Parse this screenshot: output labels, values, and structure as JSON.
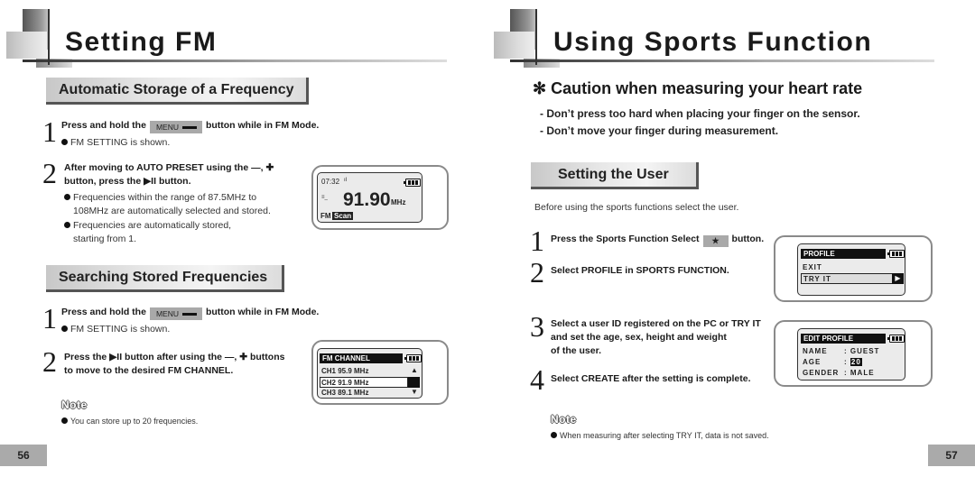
{
  "left_page": {
    "title": "Setting FM",
    "section1": {
      "heading": "Automatic Storage of a Frequency",
      "step1": {
        "num": "1",
        "text_before": "Press and hold the",
        "key_label": "MENU",
        "text_after": "button while in FM Mode.",
        "bullet": "FM SETTING is shown."
      },
      "step2": {
        "num": "2",
        "line1": "After moving to AUTO PRESET using the",
        "line1_symbols": "—, ✚",
        "line2_before": "button, press the",
        "line2_symbol": "▶II",
        "line2_after": "button.",
        "bullet1_line1": "Frequencies within the range of 87.5MHz to",
        "bullet1_line2": "108MHz are automatically selected and stored.",
        "bullet2_line1": "Frequencies are automatically stored,",
        "bullet2_line2": "starting from 1."
      },
      "lcd": {
        "time": "07:32",
        "frequency": "91.90",
        "unit": "MHz",
        "mode": "FM",
        "action": "Scan"
      }
    },
    "section2": {
      "heading": "Searching Stored Frequencies",
      "step1": {
        "num": "1",
        "text_before": "Press and hold the",
        "key_label": "MENU",
        "text_after": "button while in FM Mode.",
        "bullet": "FM SETTING is shown."
      },
      "step2": {
        "num": "2",
        "line1_before": "Press the",
        "line1_symbol": "▶II",
        "line1_mid": "button after using the",
        "line1_symbols": "—, ✚",
        "line1_after": "buttons",
        "line2": "to move to the desired FM CHANNEL."
      },
      "lcd": {
        "header": "FM CHANNEL",
        "channels": [
          {
            "label": "CH1  95.9 MHz",
            "selected": false
          },
          {
            "label": "CH2  91.9 MHz",
            "selected": true
          },
          {
            "label": "CH3  89.1 MHz",
            "selected": false
          }
        ],
        "up_arrow": "▲",
        "down_arrow": "▼"
      }
    },
    "note": {
      "label": "Note",
      "text": "You can store up to 20 frequencies."
    },
    "page_number": "56"
  },
  "right_page": {
    "title": "Using Sports Function",
    "caution": {
      "title": "✻ Caution when measuring your heart rate",
      "lines": [
        "- Don’t press too hard when placing your finger on the sensor.",
        "- Don’t move your finger during measurement."
      ]
    },
    "section": {
      "heading": "Setting the User",
      "intro": "Before using the sports functions select the user.",
      "step1": {
        "num": "1",
        "text_before": "Press the Sports Function Select",
        "key_icon": "★",
        "text_after": "button."
      },
      "step2": {
        "num": "2",
        "text": "Select PROFILE in SPORTS FUNCTION."
      },
      "step3": {
        "num": "3",
        "line1": "Select a user ID registered on the PC or TRY IT",
        "line2": "and set the age, sex, height and weight",
        "line3": "of the user."
      },
      "step4": {
        "num": "4",
        "text": "Select CREATE after the setting is complete."
      }
    },
    "lcd_profile": {
      "header": "PROFILE",
      "items": [
        "EXIT",
        "TRY IT"
      ],
      "selected_arrow": "▶"
    },
    "lcd_edit": {
      "header": "EDIT PROFILE",
      "rows": [
        {
          "key": "NAME",
          "value": ": GUEST"
        },
        {
          "key": "AGE",
          "value": "20"
        },
        {
          "key": "GENDER",
          "value": ": MALE"
        }
      ]
    },
    "note": {
      "label": "Note",
      "text": "When measuring after selecting TRY IT, data is not saved."
    },
    "page_number": "57"
  }
}
